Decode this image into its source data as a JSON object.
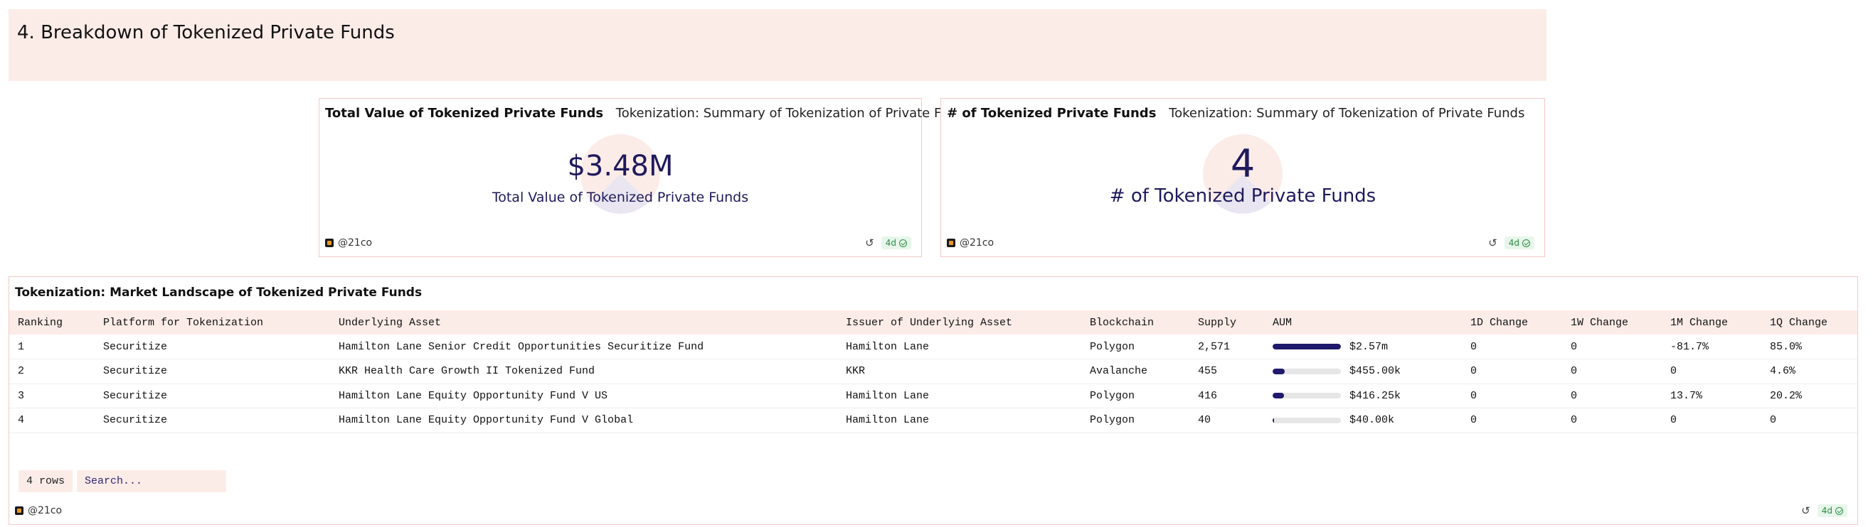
{
  "section": {
    "title": "4. Breakdown of Tokenized Private Funds"
  },
  "cards": [
    {
      "title": "Total Value of Tokenized Private Funds",
      "subtitle": "Tokenization: Summary of Tokenization of Private Funds",
      "value": "$3.48M",
      "label": "Total Value of Tokenized Private Funds",
      "author": "@21co",
      "age": "4d"
    },
    {
      "title": "# of Tokenized Private Funds",
      "subtitle": "Tokenization: Summary of Tokenization of Private Funds",
      "value": "4",
      "label": "# of Tokenized Private Funds",
      "author": "@21co",
      "age": "4d"
    }
  ],
  "table": {
    "title": "Tokenization: Market Landscape of Tokenized Private Funds",
    "columns": [
      "Ranking",
      "Platform for Tokenization",
      "Underlying Asset",
      "Issuer of Underlying Asset",
      "Blockchain",
      "Supply",
      "AUM",
      "1D Change",
      "1W Change",
      "1M Change",
      "1Q Change"
    ],
    "rows": [
      {
        "ranking": "1",
        "platform": "Securitize",
        "asset": "Hamilton Lane Senior Credit Opportunities Securitize Fund",
        "issuer": "Hamilton Lane",
        "chain": "Polygon",
        "supply": "2,571",
        "aum": "$2.57m",
        "aum_fraction": 1.0,
        "d1": "0",
        "w1": "0",
        "m1": "-81.7%",
        "q1": "85.0%"
      },
      {
        "ranking": "2",
        "platform": "Securitize",
        "asset": "KKR Health Care Growth II Tokenized Fund",
        "issuer": "KKR",
        "chain": "Avalanche",
        "supply": "455",
        "aum": "$455.00k",
        "aum_fraction": 0.177,
        "d1": "0",
        "w1": "0",
        "m1": "0",
        "q1": "4.6%"
      },
      {
        "ranking": "3",
        "platform": "Securitize",
        "asset": "Hamilton Lane Equity Opportunity Fund V US",
        "issuer": "Hamilton Lane",
        "chain": "Polygon",
        "supply": "416",
        "aum": "$416.25k",
        "aum_fraction": 0.162,
        "d1": "0",
        "w1": "0",
        "m1": "13.7%",
        "q1": "20.2%"
      },
      {
        "ranking": "4",
        "platform": "Securitize",
        "asset": "Hamilton Lane Equity Opportunity Fund V Global",
        "issuer": "Hamilton Lane",
        "chain": "Polygon",
        "supply": "40",
        "aum": "$40.00k",
        "aum_fraction": 0.016,
        "d1": "0",
        "w1": "0",
        "m1": "0",
        "q1": "0"
      }
    ],
    "rows_count": "4 rows",
    "search_placeholder": "Search...",
    "author": "@21co",
    "age": "4d"
  },
  "colors": {
    "accent_bg": "#fcece8",
    "counter_text": "#1f1a5c",
    "positive": "#2e7d32",
    "negative": "#d0432f",
    "fresh_badge": "#2e8b45"
  }
}
